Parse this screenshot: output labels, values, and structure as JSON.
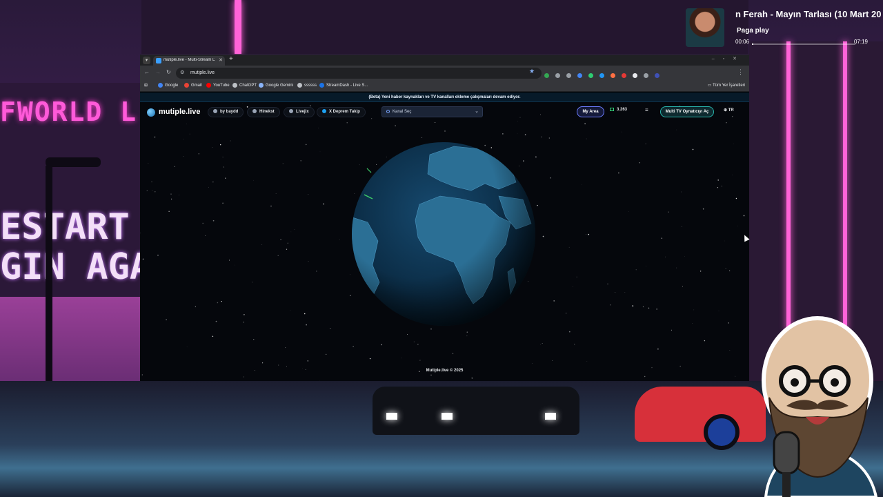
{
  "background": {
    "sign_left": "FWORLD L",
    "restart_line1": "ESTART",
    "restart_line2": "GIN AGAIN"
  },
  "media": {
    "title": "n Ferah - Mayın Tarlası (10 Mart 20",
    "subtitle": "Paga play",
    "time_current": "00:06",
    "time_total": "07:19",
    "progress_fraction": 0.014
  },
  "browser": {
    "tab_title": "mutiple.live - Multi-Stream Da",
    "url": "mutiple.live",
    "bookmarks": [
      {
        "label": "Google",
        "color": "#4285f4"
      },
      {
        "label": "Gmail",
        "color": "#ea4335"
      },
      {
        "label": "YouTube",
        "color": "#ff0000"
      },
      {
        "label": "ChatGPT",
        "color": "#bdc1c6"
      },
      {
        "label": "Google Gemini",
        "color": "#8ab4f8"
      },
      {
        "label": "ssssss",
        "color": "#bdc1c6"
      },
      {
        "label": "StreamDash - Live S...",
        "color": "#1a73e8"
      }
    ],
    "all_bookmarks": "Tüm Yer İşaretleri",
    "extensions": [
      "#34a853",
      "#9aa0a6",
      "#9aa0a6",
      "#4285f4",
      "#2ecc71",
      "#2196f3",
      "#ff7043",
      "#e53935",
      "#e8eaed",
      "#9aa0a6",
      "#3f51b5"
    ]
  },
  "site": {
    "banner": "(Beta) Yeni haber kaynakları ve TV kanalları ekleme çalışmaları devam ediyor.",
    "brand": "mutiple.live",
    "nav": {
      "by_baydd": "by baydd",
      "hinekst": "Hinekst",
      "livejix": "Livejix",
      "x_deprem": "X Deprem Takip",
      "channel_select": "Kanal Seç",
      "my_area": "My Area",
      "viewers": "3.263",
      "multi_tv": "Multi TV Oynatıcıyı Aç",
      "lang": "TR"
    },
    "footer": "Mutiple.live © 2025",
    "colors": {
      "accent_purple": "#6c7cff",
      "accent_teal": "#29b6ad",
      "globe_ocean": "#0e3552",
      "globe_land": "#2b6f95"
    }
  }
}
